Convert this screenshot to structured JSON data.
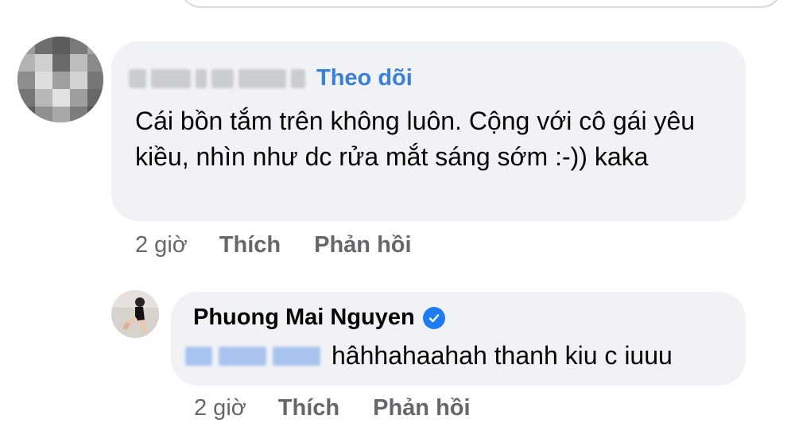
{
  "comment": {
    "follow_label": "Theo dõi",
    "text": "Cái bồn tắm trên không luôn. Cộng với cô gái yêu kiều, nhìn như dc rửa mắt sáng sớm :-)) kaka",
    "time": "2 giờ",
    "like_label": "Thích",
    "reply_label": "Phản hồi"
  },
  "reply": {
    "author": "Phuong Mai Nguyen",
    "text": "hâhhahaahah thanh kiu c iuuu",
    "time": "2 giờ",
    "like_label": "Thích",
    "reply_label": "Phản hồi"
  },
  "colors": {
    "bubble": "#f0f2f5",
    "link": "#3a80d6",
    "meta": "#65676b",
    "verified": "#1d7cf2"
  },
  "icons": {
    "verified": "verified-check-icon"
  }
}
